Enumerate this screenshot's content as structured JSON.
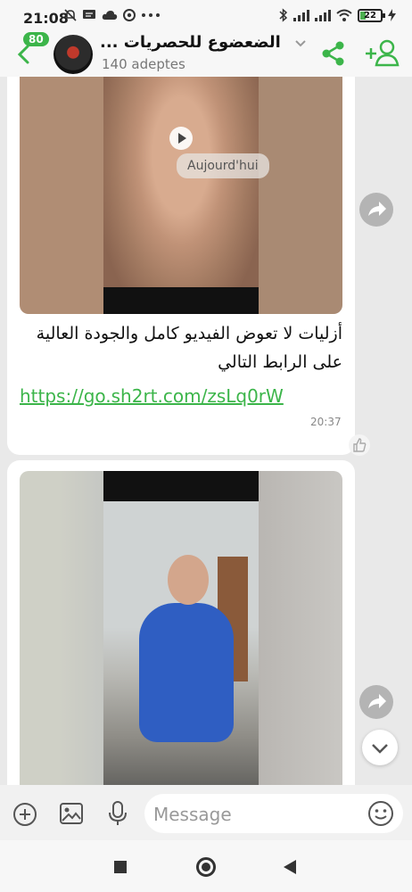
{
  "status_bar": {
    "time": "21:08",
    "battery_level": "22",
    "left_icons": [
      "mute-icon",
      "message-icon",
      "cloud-icon",
      "chrome-icon",
      "more-dots-icon"
    ],
    "right_icons": [
      "bluetooth-icon",
      "signal-icon",
      "signal-icon",
      "wifi-icon",
      "battery-icon",
      "charging-icon"
    ]
  },
  "header": {
    "unread_count": "80",
    "channel_title": "الضعضوع للحصريات ...",
    "subscriber_count": "140 adeptes",
    "accent": "#3cb54a"
  },
  "chat": {
    "date_chip": "Aujourd'hui",
    "messages": [
      {
        "type": "video",
        "text": "أزليات لا تعوض الفيديو كامل والجودة العالية على الرابط التالي",
        "link": "https://go.sh2rt.com/zsLq0rW",
        "time": "20:37"
      },
      {
        "type": "video"
      }
    ]
  },
  "input": {
    "placeholder": "Message"
  }
}
